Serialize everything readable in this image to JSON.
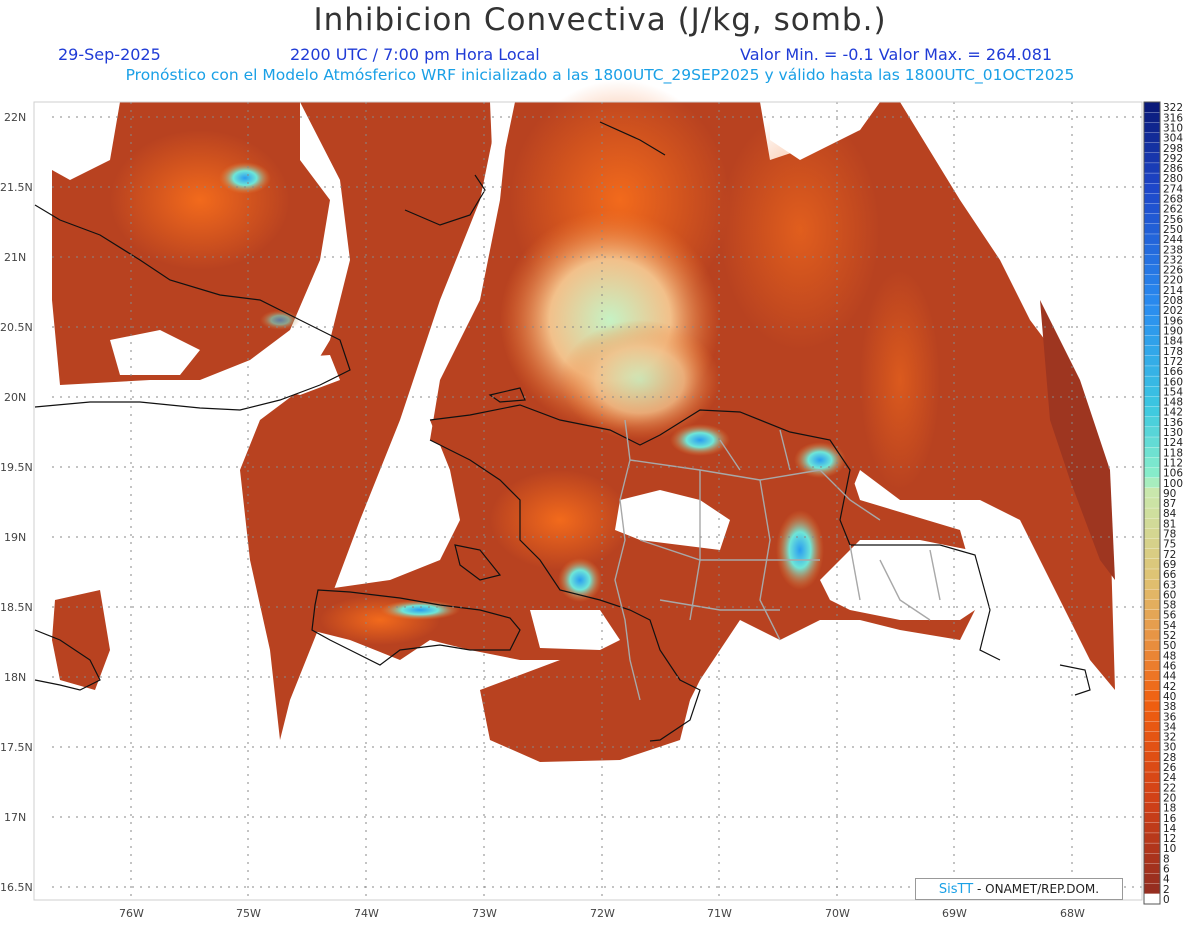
{
  "header": {
    "title": "Inhibicion Convectiva (J/kg, somb.)",
    "date": "29-Sep-2025",
    "time": "2200 UTC / 7:00 pm Hora Local",
    "min_max": "Valor Min. = -0.1  Valor Max. = 264.081",
    "description": "Pronóstico con el Modelo Atmósferico WRF inicializado a las 1800UTC_29SEP2025 y válido hasta las  1800UTC_01OCT2025"
  },
  "axes": {
    "lat_labels": [
      "22N",
      "21.5N",
      "21N",
      "20.5N",
      "20N",
      "19.5N",
      "19N",
      "18.5N",
      "18N",
      "17.5N",
      "17N",
      "16.5N"
    ],
    "lon_labels": [
      "76W",
      "75W",
      "74W",
      "73W",
      "72W",
      "71W",
      "70W",
      "69W",
      "68W"
    ]
  },
  "colorbar": {
    "labels": [
      "322",
      "316",
      "310",
      "304",
      "298",
      "292",
      "286",
      "280",
      "274",
      "268",
      "262",
      "256",
      "250",
      "244",
      "238",
      "232",
      "226",
      "220",
      "214",
      "208",
      "202",
      "196",
      "190",
      "184",
      "178",
      "172",
      "166",
      "160",
      "154",
      "148",
      "142",
      "136",
      "130",
      "124",
      "118",
      "112",
      "106",
      "100",
      "90",
      "87",
      "84",
      "81",
      "78",
      "75",
      "72",
      "69",
      "66",
      "63",
      "60",
      "58",
      "56",
      "54",
      "52",
      "50",
      "48",
      "46",
      "44",
      "42",
      "40",
      "38",
      "36",
      "34",
      "32",
      "30",
      "28",
      "26",
      "24",
      "22",
      "20",
      "18",
      "16",
      "14",
      "12",
      "10",
      "8",
      "6",
      "4",
      "2",
      "0"
    ],
    "colors": {
      "high": "#0a1a7a",
      "mid_blue": "#2a8cf0",
      "cyan": "#3cc8e0",
      "aqua": "#8ef0c8",
      "pale": "#c8eab0",
      "tan": "#e0c070",
      "orange": "#f06010",
      "red_orange": "#d04018",
      "dark_red": "#9a3020",
      "zero": "#ffffff"
    }
  },
  "credit": {
    "sis": "SisTT",
    "text": " - ONAMET/REP.DOM."
  },
  "map_colors": {
    "background": "#b84220",
    "coast": "#111111",
    "borders": "#a8a8a8",
    "grid": "#888888"
  }
}
